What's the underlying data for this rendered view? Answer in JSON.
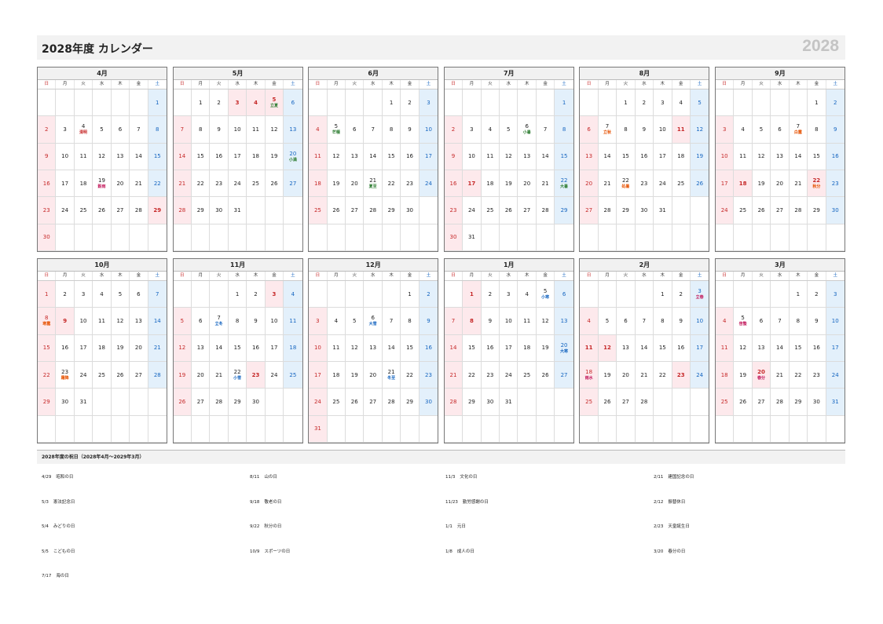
{
  "header": {
    "title": "2028年度 カレンダー",
    "year": "2028"
  },
  "weekdays": [
    "日",
    "月",
    "火",
    "水",
    "木",
    "金",
    "土"
  ],
  "months": [
    {
      "name": "4月",
      "start": 6,
      "days": 30,
      "holidays": [
        29
      ],
      "labels": {
        "4": {
          "text": "清明",
          "color": "red"
        },
        "19": {
          "text": "穀雨",
          "color": "pink"
        }
      }
    },
    {
      "name": "5月",
      "start": 1,
      "days": 31,
      "holidays": [
        3,
        4,
        5
      ],
      "labels": {
        "5": {
          "text": "立夏",
          "color": "green"
        },
        "20": {
          "text": "小満",
          "color": "green"
        }
      }
    },
    {
      "name": "6月",
      "start": 4,
      "days": 30,
      "holidays": [],
      "labels": {
        "5": {
          "text": "芒種",
          "color": "green"
        },
        "21": {
          "text": "夏至",
          "color": "green"
        }
      }
    },
    {
      "name": "7月",
      "start": 6,
      "days": 31,
      "holidays": [
        17
      ],
      "labels": {
        "6": {
          "text": "小暑",
          "color": "green"
        },
        "22": {
          "text": "大暑",
          "color": "green"
        }
      }
    },
    {
      "name": "8月",
      "start": 2,
      "days": 31,
      "holidays": [
        11
      ],
      "labels": {
        "7": {
          "text": "立秋",
          "color": "orange"
        },
        "22": {
          "text": "処暑",
          "color": "orange"
        }
      }
    },
    {
      "name": "9月",
      "start": 5,
      "days": 30,
      "holidays": [
        18,
        22
      ],
      "labels": {
        "7": {
          "text": "白露",
          "color": "orange"
        },
        "22": {
          "text": "秋分",
          "color": "orange"
        }
      }
    },
    {
      "name": "10月",
      "start": 0,
      "days": 31,
      "holidays": [
        9
      ],
      "labels": {
        "8": {
          "text": "寒露",
          "color": "orange"
        },
        "23": {
          "text": "霜降",
          "color": "orange"
        }
      }
    },
    {
      "name": "11月",
      "start": 3,
      "days": 30,
      "holidays": [
        3,
        23
      ],
      "labels": {
        "7": {
          "text": "立冬",
          "color": "blue"
        },
        "22": {
          "text": "小雪",
          "color": "blue"
        }
      }
    },
    {
      "name": "12月",
      "start": 5,
      "days": 31,
      "holidays": [],
      "labels": {
        "6": {
          "text": "大雪",
          "color": "blue"
        },
        "21": {
          "text": "冬至",
          "color": "blue"
        }
      }
    },
    {
      "name": "1月",
      "start": 1,
      "days": 31,
      "holidays": [
        1,
        8
      ],
      "labels": {
        "5": {
          "text": "小寒",
          "color": "blue"
        },
        "20": {
          "text": "大寒",
          "color": "blue"
        }
      }
    },
    {
      "name": "2月",
      "start": 4,
      "days": 28,
      "holidays": [
        11,
        12,
        23
      ],
      "labels": {
        "3": {
          "text": "立春",
          "color": "pink"
        },
        "18": {
          "text": "雨水",
          "color": "pink"
        }
      }
    },
    {
      "name": "3月",
      "start": 4,
      "days": 31,
      "holidays": [
        20
      ],
      "labels": {
        "5": {
          "text": "啓蟄",
          "color": "pink"
        },
        "20": {
          "text": "春分",
          "color": "pink"
        }
      }
    }
  ],
  "holiday_section": {
    "title": "2028年度の祝日（2028年4月～2029年3月）",
    "columns": [
      [
        {
          "date": "4/29",
          "name": "昭和の日"
        },
        {
          "date": "5/3",
          "name": "憲法記念日"
        },
        {
          "date": "5/4",
          "name": "みどりの日"
        },
        {
          "date": "5/5",
          "name": "こどもの日"
        },
        {
          "date": "7/17",
          "name": "海の日"
        }
      ],
      [
        {
          "date": "8/11",
          "name": "山の日"
        },
        {
          "date": "9/18",
          "name": "敬老の日"
        },
        {
          "date": "9/22",
          "name": "秋分の日"
        },
        {
          "date": "10/9",
          "name": "スポーツの日"
        }
      ],
      [
        {
          "date": "11/3",
          "name": "文化の日"
        },
        {
          "date": "11/23",
          "name": "勤労感謝の日"
        },
        {
          "date": "1/1",
          "name": "元日"
        },
        {
          "date": "1/8",
          "name": "成人の日"
        }
      ],
      [
        {
          "date": "2/11",
          "name": "建国記念の日"
        },
        {
          "date": "2/12",
          "name": "振替休日"
        },
        {
          "date": "2/23",
          "name": "天皇誕生日"
        },
        {
          "date": "3/20",
          "name": "春分の日"
        }
      ]
    ]
  }
}
